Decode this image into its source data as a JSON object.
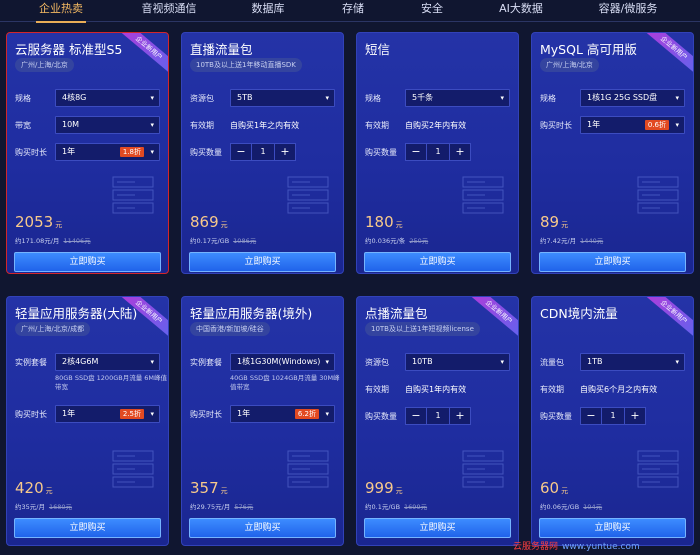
{
  "tabs": [
    "企业热卖",
    "音视频通信",
    "数据库",
    "存储",
    "安全",
    "AI大数据",
    "容器/微服务"
  ],
  "ribbon_text": "企业新用户",
  "buy_label": "立即购买",
  "cards": [
    {
      "title": "云服务器 标准型S5",
      "region": "广州/上海/北京",
      "ribbon": true,
      "rows": [
        {
          "label": "规格",
          "type": "select",
          "value": "4核8G"
        },
        {
          "label": "带宽",
          "type": "select",
          "value": "10M"
        },
        {
          "label": "购买时长",
          "type": "select",
          "value": "1年",
          "discount": "1.8折"
        }
      ],
      "price": "2053",
      "price_unit": "元",
      "sub_price": "约171.08元/月",
      "original_price": "11406元"
    },
    {
      "title": "直播流量包",
      "region": "10TB及以上送1年移动直播SDK",
      "ribbon": false,
      "rows": [
        {
          "label": "资源包",
          "type": "select",
          "value": "5TB"
        },
        {
          "label": "有效期",
          "type": "text",
          "value": "自购买1年之内有效"
        },
        {
          "label": "购买数量",
          "type": "stepper",
          "value": "1"
        }
      ],
      "price": "869",
      "price_unit": "元",
      "sub_price": "约0.17元/GB",
      "original_price": "1086元"
    },
    {
      "title": "短信",
      "region": "",
      "ribbon": false,
      "rows": [
        {
          "label": "规格",
          "type": "select",
          "value": "5千条"
        },
        {
          "label": "有效期",
          "type": "text",
          "value": "自购买2年内有效"
        },
        {
          "label": "购买数量",
          "type": "stepper",
          "value": "1"
        }
      ],
      "price": "180",
      "price_unit": "元",
      "sub_price": "约0.036元/条",
      "original_price": "250元"
    },
    {
      "title": "MySQL 高可用版",
      "region": "广州/上海/北京",
      "ribbon": true,
      "rows": [
        {
          "label": "规格",
          "type": "select",
          "value": "1核1G 25G SSD盘"
        },
        {
          "label": "购买时长",
          "type": "select",
          "value": "1年",
          "discount": "0.6折"
        }
      ],
      "price": "89",
      "price_unit": "元",
      "sub_price": "约7.42元/月",
      "original_price": "1440元"
    },
    {
      "title": "轻量应用服务器(大陆)",
      "region": "广州/上海/北京/成都",
      "ribbon": true,
      "rows": [
        {
          "label": "实例套餐",
          "type": "select",
          "value": "2核4G6M",
          "note": "80GB SSD盘 1200GB月流量 6M峰值带宽"
        },
        {
          "label": "购买时长",
          "type": "select",
          "value": "1年",
          "discount": "2.5折"
        }
      ],
      "price": "420",
      "price_unit": "元",
      "sub_price": "约35元/月",
      "original_price": "1680元"
    },
    {
      "title": "轻量应用服务器(境外)",
      "region": "中国香港/新加坡/硅谷",
      "ribbon": false,
      "rows": [
        {
          "label": "实例套餐",
          "type": "select",
          "value": "1核1G30M(Windows)",
          "note": "40GB SSD盘 1024GB月流量 30M峰值带宽"
        },
        {
          "label": "购买时长",
          "type": "select",
          "value": "1年",
          "discount": "6.2折"
        }
      ],
      "price": "357",
      "price_unit": "元",
      "sub_price": "约29.75元/月",
      "original_price": "576元"
    },
    {
      "title": "点播流量包",
      "region": "10TB及以上送1年短视频license",
      "ribbon": true,
      "rows": [
        {
          "label": "资源包",
          "type": "select",
          "value": "10TB"
        },
        {
          "label": "有效期",
          "type": "text",
          "value": "自购买1年内有效"
        },
        {
          "label": "购买数量",
          "type": "stepper",
          "value": "1"
        }
      ],
      "price": "999",
      "price_unit": "元",
      "sub_price": "约0.1元/GB",
      "original_price": "1699元"
    },
    {
      "title": "CDN境内流量",
      "region": "",
      "ribbon": true,
      "rows": [
        {
          "label": "流量包",
          "type": "select",
          "value": "1TB"
        },
        {
          "label": "有效期",
          "type": "text",
          "value": "自购买6个月之内有效"
        },
        {
          "label": "购买数量",
          "type": "stepper",
          "value": "1"
        }
      ],
      "price": "60",
      "price_unit": "元",
      "sub_price": "约0.06元/GB",
      "original_price": "104元"
    }
  ],
  "watermark": {
    "name": "云服务器网",
    "url": "www.yuntue.com"
  }
}
